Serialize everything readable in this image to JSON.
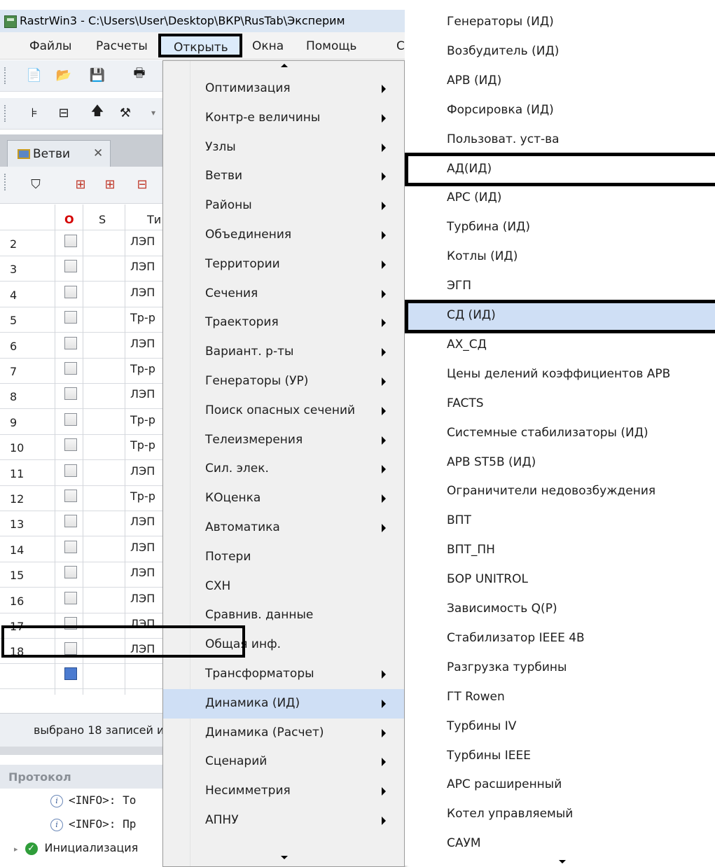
{
  "window": {
    "title": "RastrWin3 - C:\\Users\\User\\Desktop\\ВКР\\RusTab\\Эксперим"
  },
  "menubar": {
    "files": "Файлы",
    "calcs": "Расчеты",
    "open": "Открыть",
    "windows": "Окна",
    "help": "Помощь",
    "extra": "С"
  },
  "tab": {
    "label": "Ветви",
    "close": "✕"
  },
  "grid": {
    "headers": {
      "o": "O",
      "s": "S",
      "type": "Ти"
    },
    "rows": [
      {
        "n": "2",
        "type": "ЛЭП"
      },
      {
        "n": "3",
        "type": "ЛЭП"
      },
      {
        "n": "4",
        "type": "ЛЭП"
      },
      {
        "n": "5",
        "type": "Тр-р"
      },
      {
        "n": "6",
        "type": "ЛЭП"
      },
      {
        "n": "7",
        "type": "Тр-р"
      },
      {
        "n": "8",
        "type": "ЛЭП"
      },
      {
        "n": "9",
        "type": "Тр-р"
      },
      {
        "n": "10",
        "type": "Тр-р"
      },
      {
        "n": "11",
        "type": "ЛЭП"
      },
      {
        "n": "12",
        "type": "Тр-р"
      },
      {
        "n": "13",
        "type": "ЛЭП"
      },
      {
        "n": "14",
        "type": "ЛЭП"
      },
      {
        "n": "15",
        "type": "ЛЭП"
      },
      {
        "n": "16",
        "type": "ЛЭП"
      },
      {
        "n": "17",
        "type": "ЛЭП"
      },
      {
        "n": "18",
        "type": "ЛЭП"
      }
    ]
  },
  "status": {
    "text": "выбрано 18 записей и"
  },
  "protocol": {
    "title": "Протокол",
    "lines": [
      "<INFO>: То",
      "<INFO>: Пр"
    ],
    "tree_item": "Инициализация"
  },
  "menu1": {
    "items": [
      {
        "label": "Оптимизация",
        "sub": true
      },
      {
        "label": "Контр-е величины",
        "sub": true
      },
      {
        "label": "Узлы",
        "sub": true
      },
      {
        "label": "Ветви",
        "sub": true
      },
      {
        "label": "Районы",
        "sub": true
      },
      {
        "label": "Объединения",
        "sub": true
      },
      {
        "label": "Территории",
        "sub": true
      },
      {
        "label": "Сечения",
        "sub": true
      },
      {
        "label": "Траектория",
        "sub": true
      },
      {
        "label": "Вариант. р-ты",
        "sub": true
      },
      {
        "label": "Генераторы (УР)",
        "sub": true
      },
      {
        "label": "Поиск опасных сечений",
        "sub": true
      },
      {
        "label": "Телеизмерения",
        "sub": true
      },
      {
        "label": "Сил. элек.",
        "sub": true
      },
      {
        "label": "КОценка",
        "sub": true
      },
      {
        "label": "Автоматика",
        "sub": true
      },
      {
        "label": "Потери",
        "sub": false
      },
      {
        "label": "СХН",
        "sub": false
      },
      {
        "label": "Сравнив. данные",
        "sub": false
      },
      {
        "label": "Общая инф.",
        "sub": false
      },
      {
        "label": "Трансформаторы",
        "sub": true
      },
      {
        "label": "Динамика (ИД)",
        "sub": true
      },
      {
        "label": "Динамика (Расчет)",
        "sub": true
      },
      {
        "label": "Сценарий",
        "sub": true
      },
      {
        "label": "Несимметрия",
        "sub": true
      },
      {
        "label": "АПНУ",
        "sub": true
      }
    ]
  },
  "menu2": {
    "items": [
      "Генераторы (ИД)",
      "Возбудитель (ИД)",
      "АРВ (ИД)",
      "Форсировка (ИД)",
      "Пользоват. уст-ва",
      "АД(ИД)",
      "АРС  (ИД)",
      "Турбина (ИД)",
      "Котлы (ИД)",
      "ЭГП",
      "СД (ИД)",
      "АХ_СД",
      "Цены делений коэффициентов АРВ",
      "FACTS",
      "Системные стабилизаторы (ИД)",
      "АРВ ST5B (ИД)",
      "Ограничители недовозбуждения",
      "ВПТ",
      "ВПТ_ПН",
      "БОР UNITROL",
      "Зависимость Q(P)",
      "Стабилизатор IEEE 4B",
      "Разгрузка турбины",
      "ГТ Rowen",
      "Турбины IV",
      "Турбины IEEE",
      "АРС расширенный",
      "Котел управляемый",
      "САУМ"
    ]
  }
}
